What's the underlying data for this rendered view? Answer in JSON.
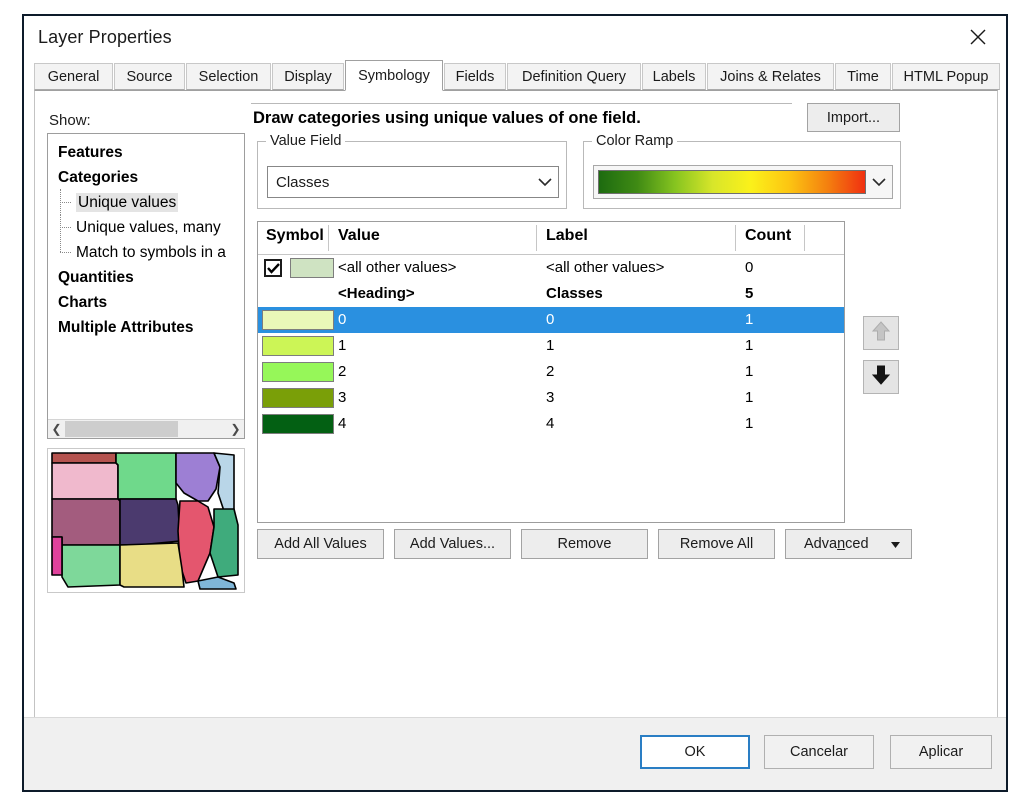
{
  "window": {
    "title": "Layer Properties",
    "close_icon": "close-icon"
  },
  "tabs": [
    {
      "label": "General",
      "active": false
    },
    {
      "label": "Source",
      "active": false
    },
    {
      "label": "Selection",
      "active": false
    },
    {
      "label": "Display",
      "active": false
    },
    {
      "label": "Symbology",
      "active": true
    },
    {
      "label": "Fields",
      "active": false
    },
    {
      "label": "Definition Query",
      "active": false
    },
    {
      "label": "Labels",
      "active": false
    },
    {
      "label": "Joins & Relates",
      "active": false
    },
    {
      "label": "Time",
      "active": false
    },
    {
      "label": "HTML Popup",
      "active": false
    }
  ],
  "show": {
    "label": "Show:",
    "tree": [
      {
        "label": "Features",
        "bold": true,
        "child": false,
        "selected": false
      },
      {
        "label": "Categories",
        "bold": true,
        "child": false,
        "selected": false
      },
      {
        "label": "Unique values",
        "bold": false,
        "child": true,
        "selected": true
      },
      {
        "label": "Unique values, many",
        "bold": false,
        "child": true,
        "selected": false
      },
      {
        "label": "Match to symbols in a",
        "bold": false,
        "child": true,
        "selected": false
      },
      {
        "label": "Quantities",
        "bold": true,
        "child": false,
        "selected": false
      },
      {
        "label": "Charts",
        "bold": true,
        "child": false,
        "selected": false
      },
      {
        "label": "Multiple Attributes",
        "bold": true,
        "child": false,
        "selected": false
      }
    ],
    "scroll_left_icon": "chevron-left-icon",
    "scroll_right_icon": "chevron-right-icon"
  },
  "preview": {
    "name": "map-preview-thumbnail",
    "polygon_colors": [
      "#b5534f",
      "#f0b9cd",
      "#6fd98b",
      "#9d7fd4",
      "#b9d6e8",
      "#a35c7e",
      "#4b3a6e",
      "#e4566e",
      "#3fab7c",
      "#7ed89a",
      "#e8dd86",
      "#e0429c",
      "#7fb6d8"
    ]
  },
  "symbology": {
    "headline": "Draw categories using unique values of one field.",
    "import_label": "Import...",
    "value_field": {
      "group_title": "Value Field",
      "selected": "Classes"
    },
    "color_ramp": {
      "group_title": "Color Ramp",
      "stops": [
        "#1d6b10",
        "#3f8a14",
        "#86c420",
        "#d8e62a",
        "#fbf11a",
        "#fcc512",
        "#f4810f",
        "#f03010"
      ]
    },
    "table": {
      "headers": [
        "Symbol",
        "Value",
        "Label",
        "Count"
      ],
      "rows": [
        {
          "kind": "all-other",
          "checked": true,
          "swatch": "#cfe3c2",
          "value": "<all other values>",
          "label": "<all other values>",
          "count": "0",
          "selected": false
        },
        {
          "kind": "heading",
          "swatch": null,
          "value": "<Heading>",
          "label": "Classes",
          "count": "5",
          "selected": false
        },
        {
          "kind": "class",
          "swatch": "#eaf7b8",
          "value": "0",
          "label": "0",
          "count": "1",
          "selected": true
        },
        {
          "kind": "class",
          "swatch": "#ccf556",
          "value": "1",
          "label": "1",
          "count": "1",
          "selected": false
        },
        {
          "kind": "class",
          "swatch": "#96f759",
          "value": "2",
          "label": "2",
          "count": "1",
          "selected": false
        },
        {
          "kind": "class",
          "swatch": "#7a9f08",
          "value": "3",
          "label": "3",
          "count": "1",
          "selected": false
        },
        {
          "kind": "class",
          "swatch": "#036013",
          "value": "4",
          "label": "4",
          "count": "1",
          "selected": false
        }
      ]
    },
    "move_up_icon": "arrow-up-icon",
    "move_down_icon": "arrow-down-icon",
    "move_up_enabled": false,
    "move_down_enabled": true,
    "actions": {
      "add_all_values": "Add All Values",
      "add_values": "Add Values...",
      "remove": "Remove",
      "remove_all": "Remove All",
      "advanced_before": "Adva",
      "advanced_mnemonic": "n",
      "advanced_after": "ced",
      "advanced_caret_icon": "caret-down-icon"
    }
  },
  "footer": {
    "ok": "OK",
    "cancel": "Cancelar",
    "apply": "Aplicar"
  },
  "colors": {
    "selection_blue": "#2a90e0",
    "focus_border": "#2a7ec4",
    "dialog_border": "#0d1b2a"
  }
}
